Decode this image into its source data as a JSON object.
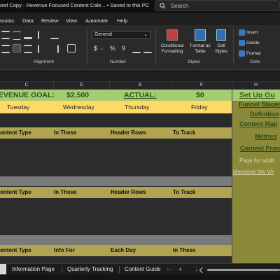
{
  "titlebar": {
    "title": "owl Copy - Revenue Focused Content Cale...  •  Saved to this PC",
    "search_placeholder": "Search"
  },
  "menubar": {
    "items": [
      "mulas",
      "Data",
      "Review",
      "View",
      "Automate",
      "Help"
    ]
  },
  "ribbon": {
    "number_format": "General",
    "groups": {
      "alignment": "Alignment",
      "number": "Number",
      "styles": "Styles",
      "cells": "Cells"
    },
    "number_symbols": {
      "currency": "$",
      "percent": "%",
      "comma": "9"
    },
    "styles": {
      "conditional": "Conditional\nFormatting",
      "format_table": "Format as\nTable",
      "cell_styles": "Cell\nStyles"
    },
    "cells": {
      "insert": "Insert",
      "delete": "Delete",
      "format": "Format"
    }
  },
  "columns": [
    "C",
    "D",
    "E",
    "F",
    "H"
  ],
  "sheet": {
    "goal_label": "EVENUE GOAL:",
    "goal_value": "$2,500",
    "actual_label": "ACTUAL:",
    "actual_value": "$0",
    "days": [
      "Tuesday",
      "Wednesday",
      "Thursday",
      "Friday"
    ],
    "header_rows": [
      [
        "ontent Type",
        "In These",
        "Header Rows",
        "To Track"
      ],
      [
        "ontent Type",
        "In These",
        "Header Rows",
        "To Track"
      ],
      [
        "ontent Type",
        "Info For",
        "Each Day",
        "In These"
      ]
    ]
  },
  "side_panel": {
    "title": "Set Up Gu",
    "links": [
      "Funnel Stages",
      "Definition",
      "Content Map",
      "Metrics",
      "Content Pron"
    ],
    "note": "Page for addit",
    "message_link": "Message the VA"
  },
  "tabs": {
    "items": [
      "Information Page",
      "Quarterly Tracking",
      "Content Guide"
    ],
    "more": "⋯",
    "add": "+",
    "menu": "⋮"
  },
  "colors": {
    "goal_bg": "#a6cc73",
    "day_bg": "#ffd966",
    "header_bg": "#b0a452",
    "side_bg": "#8a8a3a"
  }
}
